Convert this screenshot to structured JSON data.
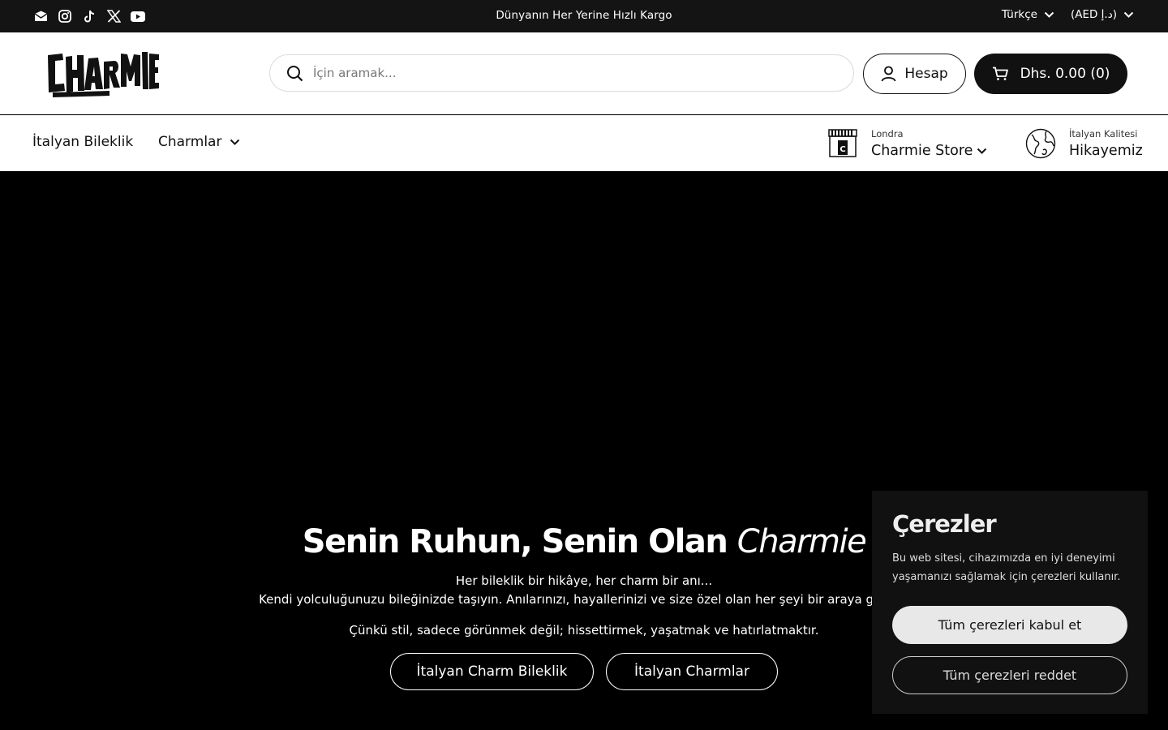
{
  "topbar": {
    "announcement": "Dünyanın Her Yerine Hızlı Kargo",
    "language": "Türkçe",
    "currency": "(AED د.إ)",
    "social_icons": [
      "email-icon",
      "instagram-icon",
      "tiktok-icon",
      "x-icon",
      "youtube-icon"
    ]
  },
  "header": {
    "logo_text": "CHARMIE",
    "search_placeholder": "İçin aramak...",
    "account_label": "Hesap",
    "cart_label": "Dhs. 0.00 (0)"
  },
  "nav": {
    "items": [
      {
        "label": "İtalyan Bileklik"
      },
      {
        "label": "Charmlar"
      }
    ],
    "store": {
      "small": "Londra",
      "big": "Charmie Store"
    },
    "story": {
      "small": "İtalyan Kalitesi",
      "big": "Hikayemiz"
    }
  },
  "hero": {
    "title_main": "Senin Ruhun, Senin Olan ",
    "title_italic": "Charmie",
    "line1": "Her bileklik bir hikâye, her charm bir anı...",
    "line2": "Kendi yolculuğunuzu bileğinizde taşıyın. Anılarınızı, hayallerinizi ve size özel olan her şeyi bir araya getirin.",
    "line3": "Çünkü stil, sadece görünmek değil; hissettirmek, yaşatmak ve hatırlatmaktır.",
    "button1": "İtalyan Charm Bileklik",
    "button2": "İtalyan Charmlar"
  },
  "cookie": {
    "title": "Çerezler",
    "text": "Bu web sitesi, cihazımızda en iyi deneyimi yaşamanızı sağlamak için çerezleri kullanır.",
    "accept": "Tüm çerezleri kabul et",
    "reject": "Tüm çerezleri reddet"
  }
}
